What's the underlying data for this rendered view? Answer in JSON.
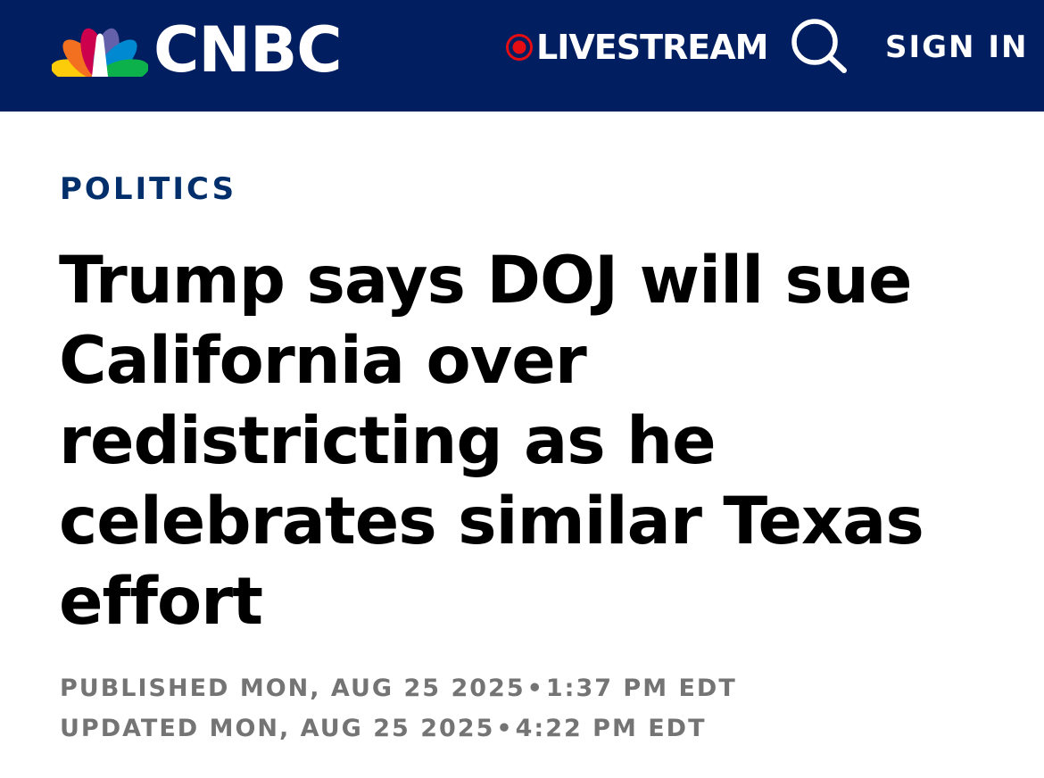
{
  "header": {
    "brand": "CNBC",
    "livestream_label": "LIVESTREAM",
    "signin_label": "SIGN IN",
    "colors": {
      "navy": "#001e60",
      "live_red": "#e40d14",
      "peacock": [
        "#fccb0a",
        "#f37021",
        "#cc004c",
        "#6460aa",
        "#0089d0",
        "#0db14b"
      ]
    },
    "icons": {
      "logo": "nbc-peacock-icon",
      "live": "live-dot-icon",
      "search": "search-icon"
    }
  },
  "article": {
    "section": "POLITICS",
    "headline": "Trump says DOJ will sue California over redistricting as he celebrates similar Texas effort",
    "published": {
      "label": "PUBLISHED",
      "date": "MON, AUG 25 2025",
      "separator": "•",
      "time": "1:37 PM EDT"
    },
    "updated": {
      "label": "UPDATED",
      "date": "MON, AUG 25 2025",
      "separator": "•",
      "time": "4:22 PM EDT"
    }
  }
}
